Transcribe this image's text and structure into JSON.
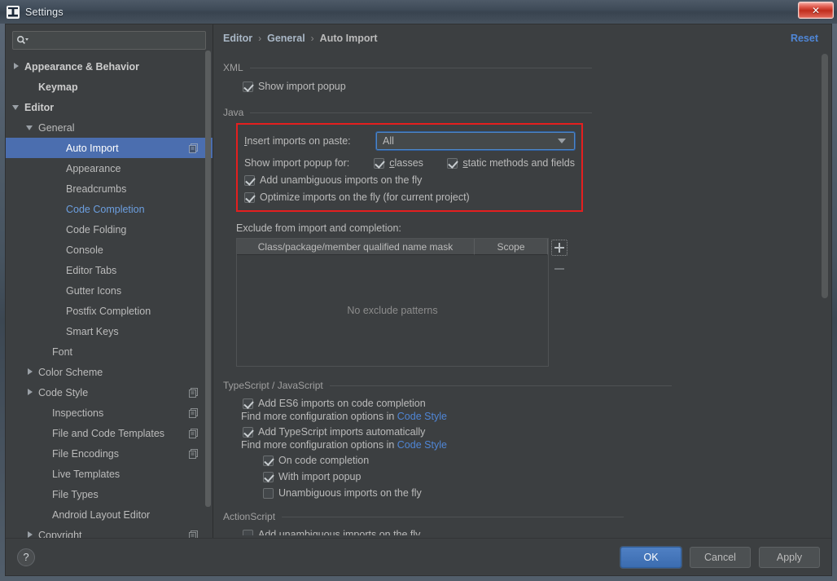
{
  "window": {
    "title": "Settings",
    "app_icon": "intellij-idea-icon",
    "close_label": "✕"
  },
  "sidebar": {
    "search": {
      "value": "",
      "placeholder": "",
      "icon": "search-icon"
    },
    "items": [
      {
        "label": "Appearance & Behavior",
        "arrow": "right",
        "indent": 0,
        "style": "bold",
        "copyable": false
      },
      {
        "label": "Keymap",
        "arrow": "none",
        "indent": 1,
        "style": "bold",
        "copyable": false
      },
      {
        "label": "Editor",
        "arrow": "down",
        "indent": 0,
        "style": "bold",
        "copyable": false
      },
      {
        "label": "General",
        "arrow": "down",
        "indent": 1,
        "style": "normal",
        "copyable": false
      },
      {
        "label": "Auto Import",
        "arrow": "none",
        "indent": 3,
        "style": "selected",
        "copyable": true
      },
      {
        "label": "Appearance",
        "arrow": "none",
        "indent": 3,
        "style": "normal",
        "copyable": false
      },
      {
        "label": "Breadcrumbs",
        "arrow": "none",
        "indent": 3,
        "style": "normal",
        "copyable": false
      },
      {
        "label": "Code Completion",
        "arrow": "none",
        "indent": 3,
        "style": "link",
        "copyable": false
      },
      {
        "label": "Code Folding",
        "arrow": "none",
        "indent": 3,
        "style": "normal",
        "copyable": false
      },
      {
        "label": "Console",
        "arrow": "none",
        "indent": 3,
        "style": "normal",
        "copyable": false
      },
      {
        "label": "Editor Tabs",
        "arrow": "none",
        "indent": 3,
        "style": "normal",
        "copyable": false
      },
      {
        "label": "Gutter Icons",
        "arrow": "none",
        "indent": 3,
        "style": "normal",
        "copyable": false
      },
      {
        "label": "Postfix Completion",
        "arrow": "none",
        "indent": 3,
        "style": "normal",
        "copyable": false
      },
      {
        "label": "Smart Keys",
        "arrow": "none",
        "indent": 3,
        "style": "normal",
        "copyable": false
      },
      {
        "label": "Font",
        "arrow": "none",
        "indent": 2,
        "style": "normal",
        "copyable": false
      },
      {
        "label": "Color Scheme",
        "arrow": "right",
        "indent": 1,
        "style": "normal",
        "copyable": false
      },
      {
        "label": "Code Style",
        "arrow": "right",
        "indent": 1,
        "style": "normal",
        "copyable": true
      },
      {
        "label": "Inspections",
        "arrow": "none",
        "indent": 2,
        "style": "normal",
        "copyable": true
      },
      {
        "label": "File and Code Templates",
        "arrow": "none",
        "indent": 2,
        "style": "normal",
        "copyable": true
      },
      {
        "label": "File Encodings",
        "arrow": "none",
        "indent": 2,
        "style": "normal",
        "copyable": true
      },
      {
        "label": "Live Templates",
        "arrow": "none",
        "indent": 2,
        "style": "normal",
        "copyable": false
      },
      {
        "label": "File Types",
        "arrow": "none",
        "indent": 2,
        "style": "normal",
        "copyable": false
      },
      {
        "label": "Android Layout Editor",
        "arrow": "none",
        "indent": 2,
        "style": "normal",
        "copyable": false
      },
      {
        "label": "Copyright",
        "arrow": "right",
        "indent": 1,
        "style": "normal",
        "copyable": true
      }
    ]
  },
  "breadcrumb": {
    "part1": "Editor",
    "sep1": "›",
    "part2": "General",
    "sep2": "›",
    "part3": "Auto Import",
    "reset_label": "Reset"
  },
  "sections": {
    "xml": {
      "title": "XML",
      "show_import_popup": {
        "label": "Show import popup",
        "checked": true
      }
    },
    "java": {
      "title": "Java",
      "highlighted": true,
      "highlight_color": "#e41f1f",
      "insert_imports": {
        "label": "Insert imports on paste:",
        "mnemonic": "I",
        "value": "All"
      },
      "show_import_popup_for": {
        "label": "Show import popup for:",
        "classes": {
          "label": "classes",
          "mnemonic": "c",
          "checked": true
        },
        "static_methods": {
          "label": "static methods and fields",
          "mnemonic": "s",
          "checked": true
        }
      },
      "add_unambiguous": {
        "label": "Add unambiguous imports on the fly",
        "checked": true
      },
      "optimize_imports": {
        "label": "Optimize imports on the fly (for current project)",
        "checked": true
      },
      "exclude": {
        "label": "Exclude from import and completion:",
        "columns": [
          "Class/package/member qualified name mask",
          "Scope"
        ],
        "rows": [],
        "empty_text": "No exclude patterns",
        "add_button": "+",
        "remove_button": "−"
      }
    },
    "typescript": {
      "title": "TypeScript / JavaScript",
      "add_es6": {
        "label": "Add ES6 imports on code completion",
        "checked": true
      },
      "hint1_prefix": "Find more configuration options in ",
      "hint1_link": "Code Style",
      "add_ts": {
        "label": "Add TypeScript imports automatically",
        "checked": true
      },
      "hint2_prefix": "Find more configuration options in ",
      "hint2_link": "Code Style",
      "on_code_completion": {
        "label": "On code completion",
        "checked": true
      },
      "with_import_popup": {
        "label": "With import popup",
        "checked": true
      },
      "unambiguous_on_fly": {
        "label": "Unambiguous imports on the fly",
        "checked": false
      }
    },
    "actionscript": {
      "title": "ActionScript",
      "add_unambiguous": {
        "label": "Add unambiguous imports on the fly",
        "checked": false
      }
    }
  },
  "footer": {
    "help_label": "?",
    "ok_label": "OK",
    "cancel_label": "Cancel",
    "apply_label": "Apply"
  },
  "colors": {
    "accent_blue": "#4b6eaf",
    "link_blue": "#4f86d6",
    "highlight_red": "#e41f1f",
    "panel_bg": "#3c3f41"
  }
}
